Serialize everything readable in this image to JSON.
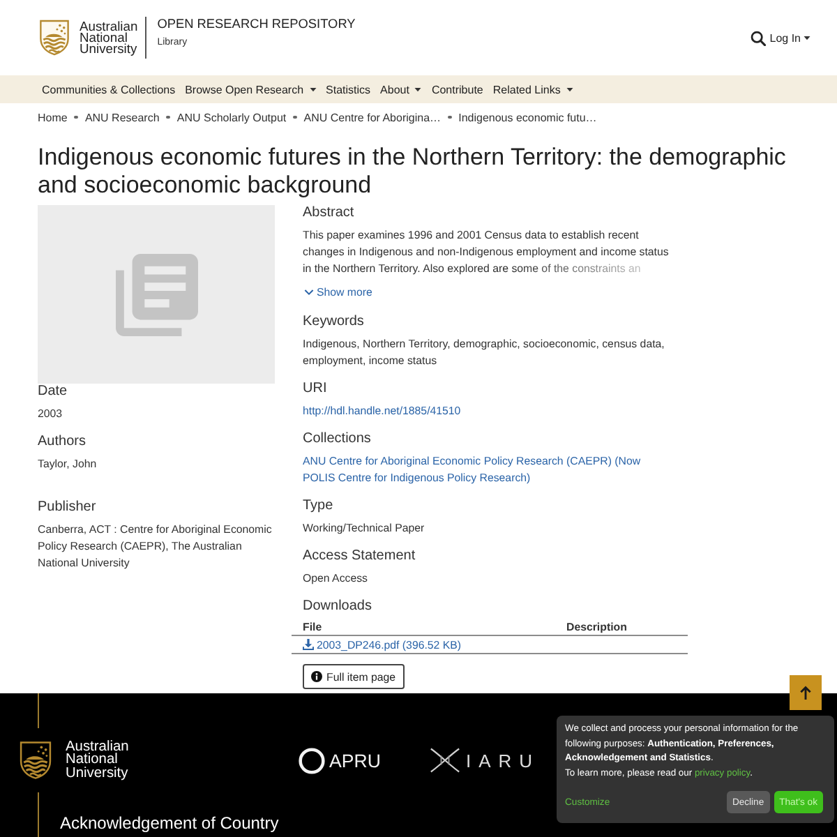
{
  "header": {
    "university": "Australian National University",
    "repository": "OPEN RESEARCH REPOSITORY",
    "subtitle": "Library",
    "login": {
      "label": "Log In",
      "dropdown": true
    }
  },
  "nav": [
    {
      "label": "Communities & Collections",
      "dropdown": false
    },
    {
      "label": "Browse Open Research",
      "dropdown": true
    },
    {
      "label": "Statistics",
      "dropdown": false
    },
    {
      "label": "About",
      "dropdown": true
    },
    {
      "label": "Contribute",
      "dropdown": false
    },
    {
      "label": "Related Links",
      "dropdown": true
    }
  ],
  "breadcrumbs": [
    "Home",
    "ANU Research",
    "ANU Scholarly Output",
    "ANU Centre for Aborigina…",
    "Indigenous economic futu…"
  ],
  "title": "Indigenous economic futures in the Northern Territory: the demographic and socioeconomic background",
  "sidebar_fields": [
    {
      "heading": "Date",
      "kind": "text",
      "value": "2003"
    },
    {
      "heading": "Authors",
      "kind": "authors",
      "value": "Taylor, John"
    },
    {
      "heading": "Publisher",
      "kind": "text",
      "value": "Canberra, ACT : Centre for Aboriginal Economic Policy Research (CAEPR), The Australian National University"
    }
  ],
  "main_fields": [
    {
      "heading": "Abstract",
      "kind": "abstract",
      "value": "This paper examines 1996 and 2001 Census data to establish recent changes in Indigenous and non-Indigenous employment and income status in the Northern Territory. Also explored are some of the constraints an",
      "toggle": "Show more"
    },
    {
      "heading": "Keywords",
      "kind": "text",
      "value": "Indigenous, Northern Territory, demographic, socioeconomic, census data, employment, income status"
    },
    {
      "heading": "URI",
      "kind": "link",
      "value": "http://hdl.handle.net/1885/41510"
    },
    {
      "heading": "Collections",
      "kind": "link",
      "value": "ANU Centre for Aboriginal Economic Policy Research (CAEPR) (Now POLIS Centre for Indigenous Policy Research)"
    },
    {
      "heading": "Type",
      "kind": "text",
      "value": "Working/Technical Paper"
    },
    {
      "heading": "Access Statement",
      "kind": "text",
      "value": "Open Access"
    }
  ],
  "downloads": {
    "heading": "Downloads",
    "columns": [
      "File",
      "Description"
    ],
    "rows": [
      {
        "file": "2003_DP246.pdf (396.52 KB)"
      }
    ]
  },
  "full_item_button": "Full item page",
  "footer": {
    "university": "Australian National University",
    "partners": [
      {
        "name": "APRU",
        "kind": "ring"
      },
      {
        "name": "IARU",
        "kind": "cross"
      }
    ],
    "acknowledgement": "Acknowledgement of Country"
  },
  "cookie_notice": {
    "text": "We collect and process your personal information for the following purposes: **Authentication, Preferences, Acknowledgement and Statistics**.",
    "learn_more": "To learn more, please read our",
    "link": "privacy policy",
    "learn_more_end": ".",
    "buttons": [
      {
        "label": "Customize",
        "kind": "link"
      },
      {
        "label": "Decline",
        "kind": "secondary"
      },
      {
        "label": "That's ok",
        "kind": "primary"
      }
    ]
  }
}
